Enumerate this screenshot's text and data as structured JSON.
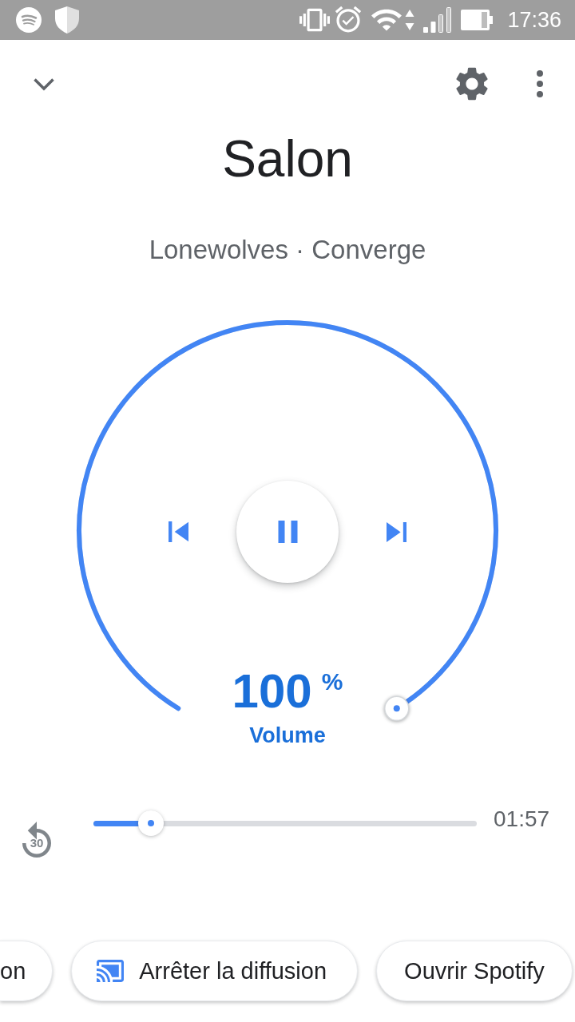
{
  "status_bar": {
    "time": "17:36"
  },
  "device": {
    "name": "Salon",
    "now_playing": "Lonewolves · Converge"
  },
  "player": {
    "playing": true
  },
  "volume": {
    "level": 1,
    "value": "100",
    "unit": "%",
    "label": "Volume"
  },
  "seek": {
    "level": 0.15,
    "time": "01:57",
    "rewind": "30"
  },
  "actions": [
    {
      "kind": "plain",
      "label": "on"
    },
    {
      "kind": "cast",
      "label": "Arrêter la diffusion"
    },
    {
      "kind": "plain",
      "label": "Ouvrir Spotify"
    }
  ]
}
